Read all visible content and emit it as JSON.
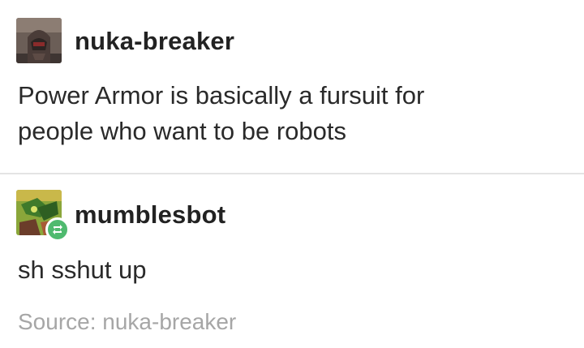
{
  "posts": [
    {
      "username": "nuka-breaker",
      "avatar_icon": "helmet-avatar-icon",
      "text": "Power Armor is basically a fursuit for\npeople who want to be robots"
    },
    {
      "username": "mumblesbot",
      "avatar_icon": "robot-avatar-icon",
      "badge_icon": "reblog-icon",
      "text": "sh sshut up"
    }
  ],
  "source": {
    "text": "Source: nuka-breaker"
  },
  "colors": {
    "reblog_badge": "#4fba6f",
    "divider": "#e4e4e4",
    "source_text": "#a6a6a6"
  }
}
